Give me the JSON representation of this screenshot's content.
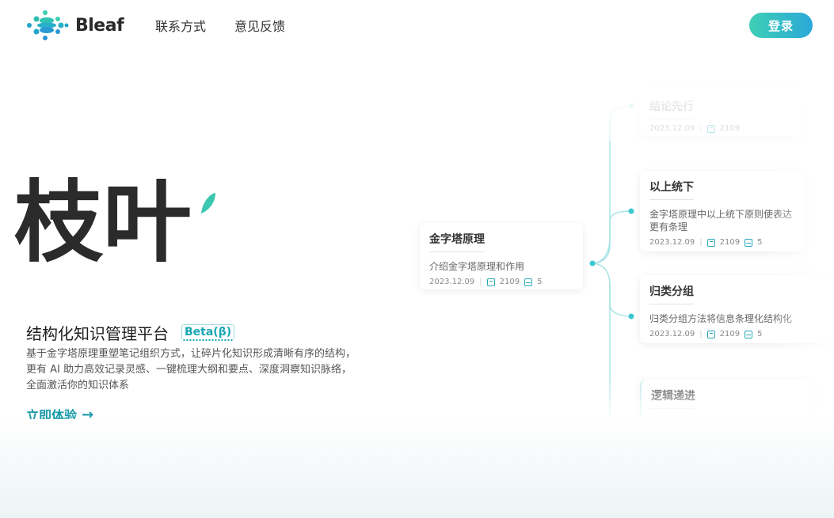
{
  "brand": {
    "name": "Bleaf"
  },
  "nav": {
    "contact": "联系方式",
    "feedback": "意见反馈"
  },
  "header": {
    "login_label": "登录"
  },
  "hero": {
    "calligraphy": "枝叶",
    "title": "结构化知识管理平台",
    "badge": "Beta(β)",
    "description": "基于金字塔原理重塑笔记组织方式，让碎片化知识形成清晰有序的结构，更有 AI 助力高效记录灵感、一键梳理大纲和要点、深度洞察知识脉络，全面激活你的知识体系",
    "cta": "立即体验"
  },
  "mindmap": {
    "root": {
      "title": "金字塔原理",
      "text": "介绍金字塔原理和作用",
      "date": "2023.12.09",
      "words": "2109",
      "images": "5"
    },
    "children": [
      {
        "title": "结论先行",
        "date": "2023.12.09",
        "words": "2109"
      },
      {
        "title": "以上统下",
        "text": "金字塔原理中以上统下原则使表达更有条理",
        "date": "2023.12.09",
        "words": "2109",
        "images": "5"
      },
      {
        "title": "归类分组",
        "text": "归类分组方法将信息条理化结构化",
        "date": "2023.12.09",
        "words": "2109",
        "images": "5"
      },
      {
        "title": "逻辑递进"
      }
    ]
  },
  "colors": {
    "accent": "#1a9ba8",
    "login_gradient_start": "#3fcfb6",
    "login_gradient_end": "#2ba8d8",
    "leaf": "#3cc8b0"
  },
  "icons": [
    "bleaf-logo-icon",
    "arrow-right-icon",
    "word-count-icon",
    "image-count-icon",
    "leaf-icon"
  ]
}
